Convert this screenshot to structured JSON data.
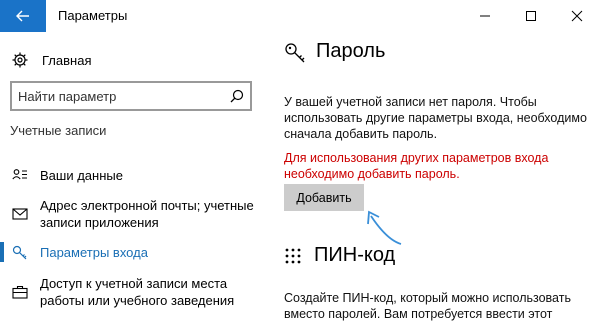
{
  "window": {
    "title": "Параметры"
  },
  "sidebar": {
    "home_label": "Главная",
    "search_placeholder": "Найти параметр",
    "section_title": "Учетные записи",
    "items": [
      {
        "label": "Ваши данные",
        "icon": "person-card-icon"
      },
      {
        "label": "Адрес электронной почты; учетные записи приложения",
        "icon": "mail-icon"
      },
      {
        "label": "Параметры входа",
        "icon": "key-icon",
        "active": true
      },
      {
        "label": "Доступ к учетной записи места работы или учебного заведения",
        "icon": "briefcase-icon"
      }
    ]
  },
  "password": {
    "heading": "Пароль",
    "description": "У вашей учетной записи нет пароля. Чтобы использовать другие параметры входа, необходимо сначала добавить пароль.",
    "warning": "Для использования других параметров входа необходимо добавить пароль.",
    "add_button": "Добавить"
  },
  "pin": {
    "heading": "ПИН-код",
    "description": "Создайте ПИН-код, который можно использовать вместо паролей. Вам потребуется ввести этот"
  },
  "colors": {
    "accent": "#1a6fb5",
    "back_button": "#1a73c8",
    "warning": "#cc0000",
    "button_bg": "#cccccc"
  }
}
